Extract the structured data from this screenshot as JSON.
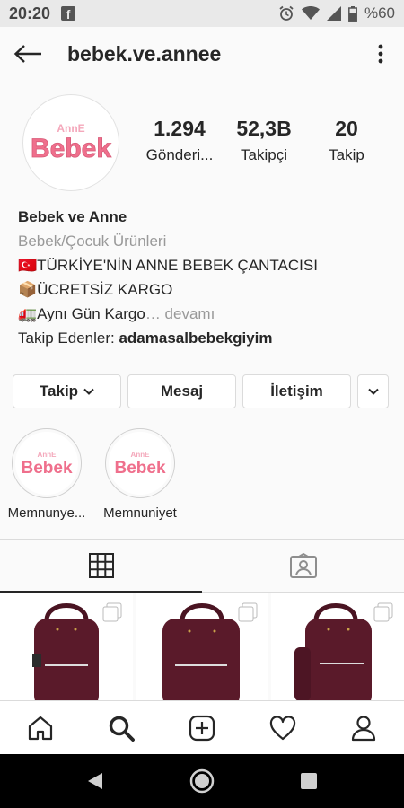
{
  "status_bar": {
    "time": "20:20",
    "battery": "%60"
  },
  "header": {
    "username": "bebek.ve.annee"
  },
  "profile": {
    "logo": {
      "small_text": "AnnE",
      "main_text": "Bebek"
    },
    "stats": [
      {
        "value": "1.294",
        "label": "Gönderi..."
      },
      {
        "value": "52,3B",
        "label": "Takipçi"
      },
      {
        "value": "20",
        "label": "Takip"
      }
    ]
  },
  "bio": {
    "name": "Bebek ve Anne",
    "category": "Bebek/Çocuk Ürünleri",
    "line1": "🇹🇷TÜRKİYE'NİN ANNE BEBEK ÇANTACISI",
    "line2": "📦ÜCRETSİZ KARGO",
    "line3": "🚛Aynı Gün Kargo",
    "more": "… devamı",
    "followed_by_label": "Takip Edenler:",
    "followed_by_user": "adamasalbebekgiyim"
  },
  "buttons": {
    "follow": "Takip",
    "message": "Mesaj",
    "contact": "İletişim"
  },
  "highlights": [
    {
      "label": "Memnunye..."
    },
    {
      "label": "Memnuniyet"
    }
  ],
  "colors": {
    "brand_pink": "#ef6f8c",
    "bag_maroon": "#5a1a2a"
  },
  "icons": {
    "tabs": [
      "grid-icon",
      "tagged-icon"
    ],
    "nav": [
      "home-icon",
      "search-icon",
      "new-post-icon",
      "activity-icon",
      "profile-icon"
    ]
  }
}
